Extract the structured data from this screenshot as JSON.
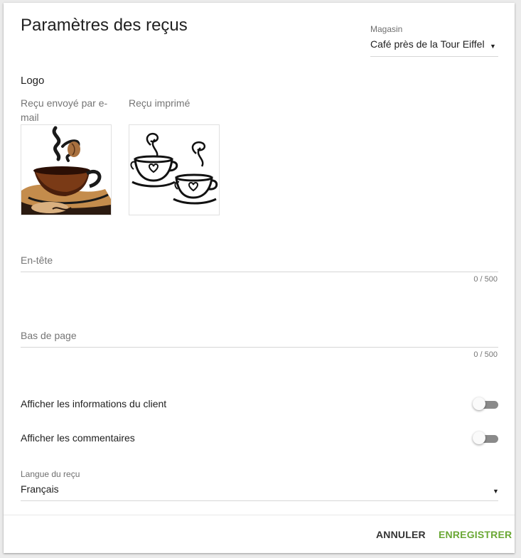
{
  "colors": {
    "accent": "#6aa834",
    "toggle_off_track": "#8a8a8a",
    "text_primary": "#212121",
    "text_secondary": "#757575"
  },
  "page": {
    "title": "Paramètres des reçus"
  },
  "store": {
    "label": "Magasin",
    "value": "Café près de la Tour Eiffel",
    "icon": "dropdown-caret-icon"
  },
  "logo": {
    "heading": "Logo",
    "email_caption": "Reçu envoyé par e-mail",
    "print_caption": "Reçu imprimé",
    "email_image": "coffee-cup-color-logo",
    "print_image": "two-coffee-cups-bw-logo"
  },
  "header_field": {
    "label": "En-tête",
    "value": "",
    "counter": "0 / 500"
  },
  "footer_field": {
    "label": "Bas de page",
    "value": "",
    "counter": "0 / 500"
  },
  "toggles": {
    "client_info": {
      "label": "Afficher les informations du client",
      "on": false
    },
    "comments": {
      "label": "Afficher les commentaires",
      "on": false
    }
  },
  "language": {
    "label": "Langue du reçu",
    "value": "Français",
    "icon": "dropdown-caret-icon"
  },
  "actions": {
    "cancel": "ANNULER",
    "save": "ENREGISTRER"
  }
}
